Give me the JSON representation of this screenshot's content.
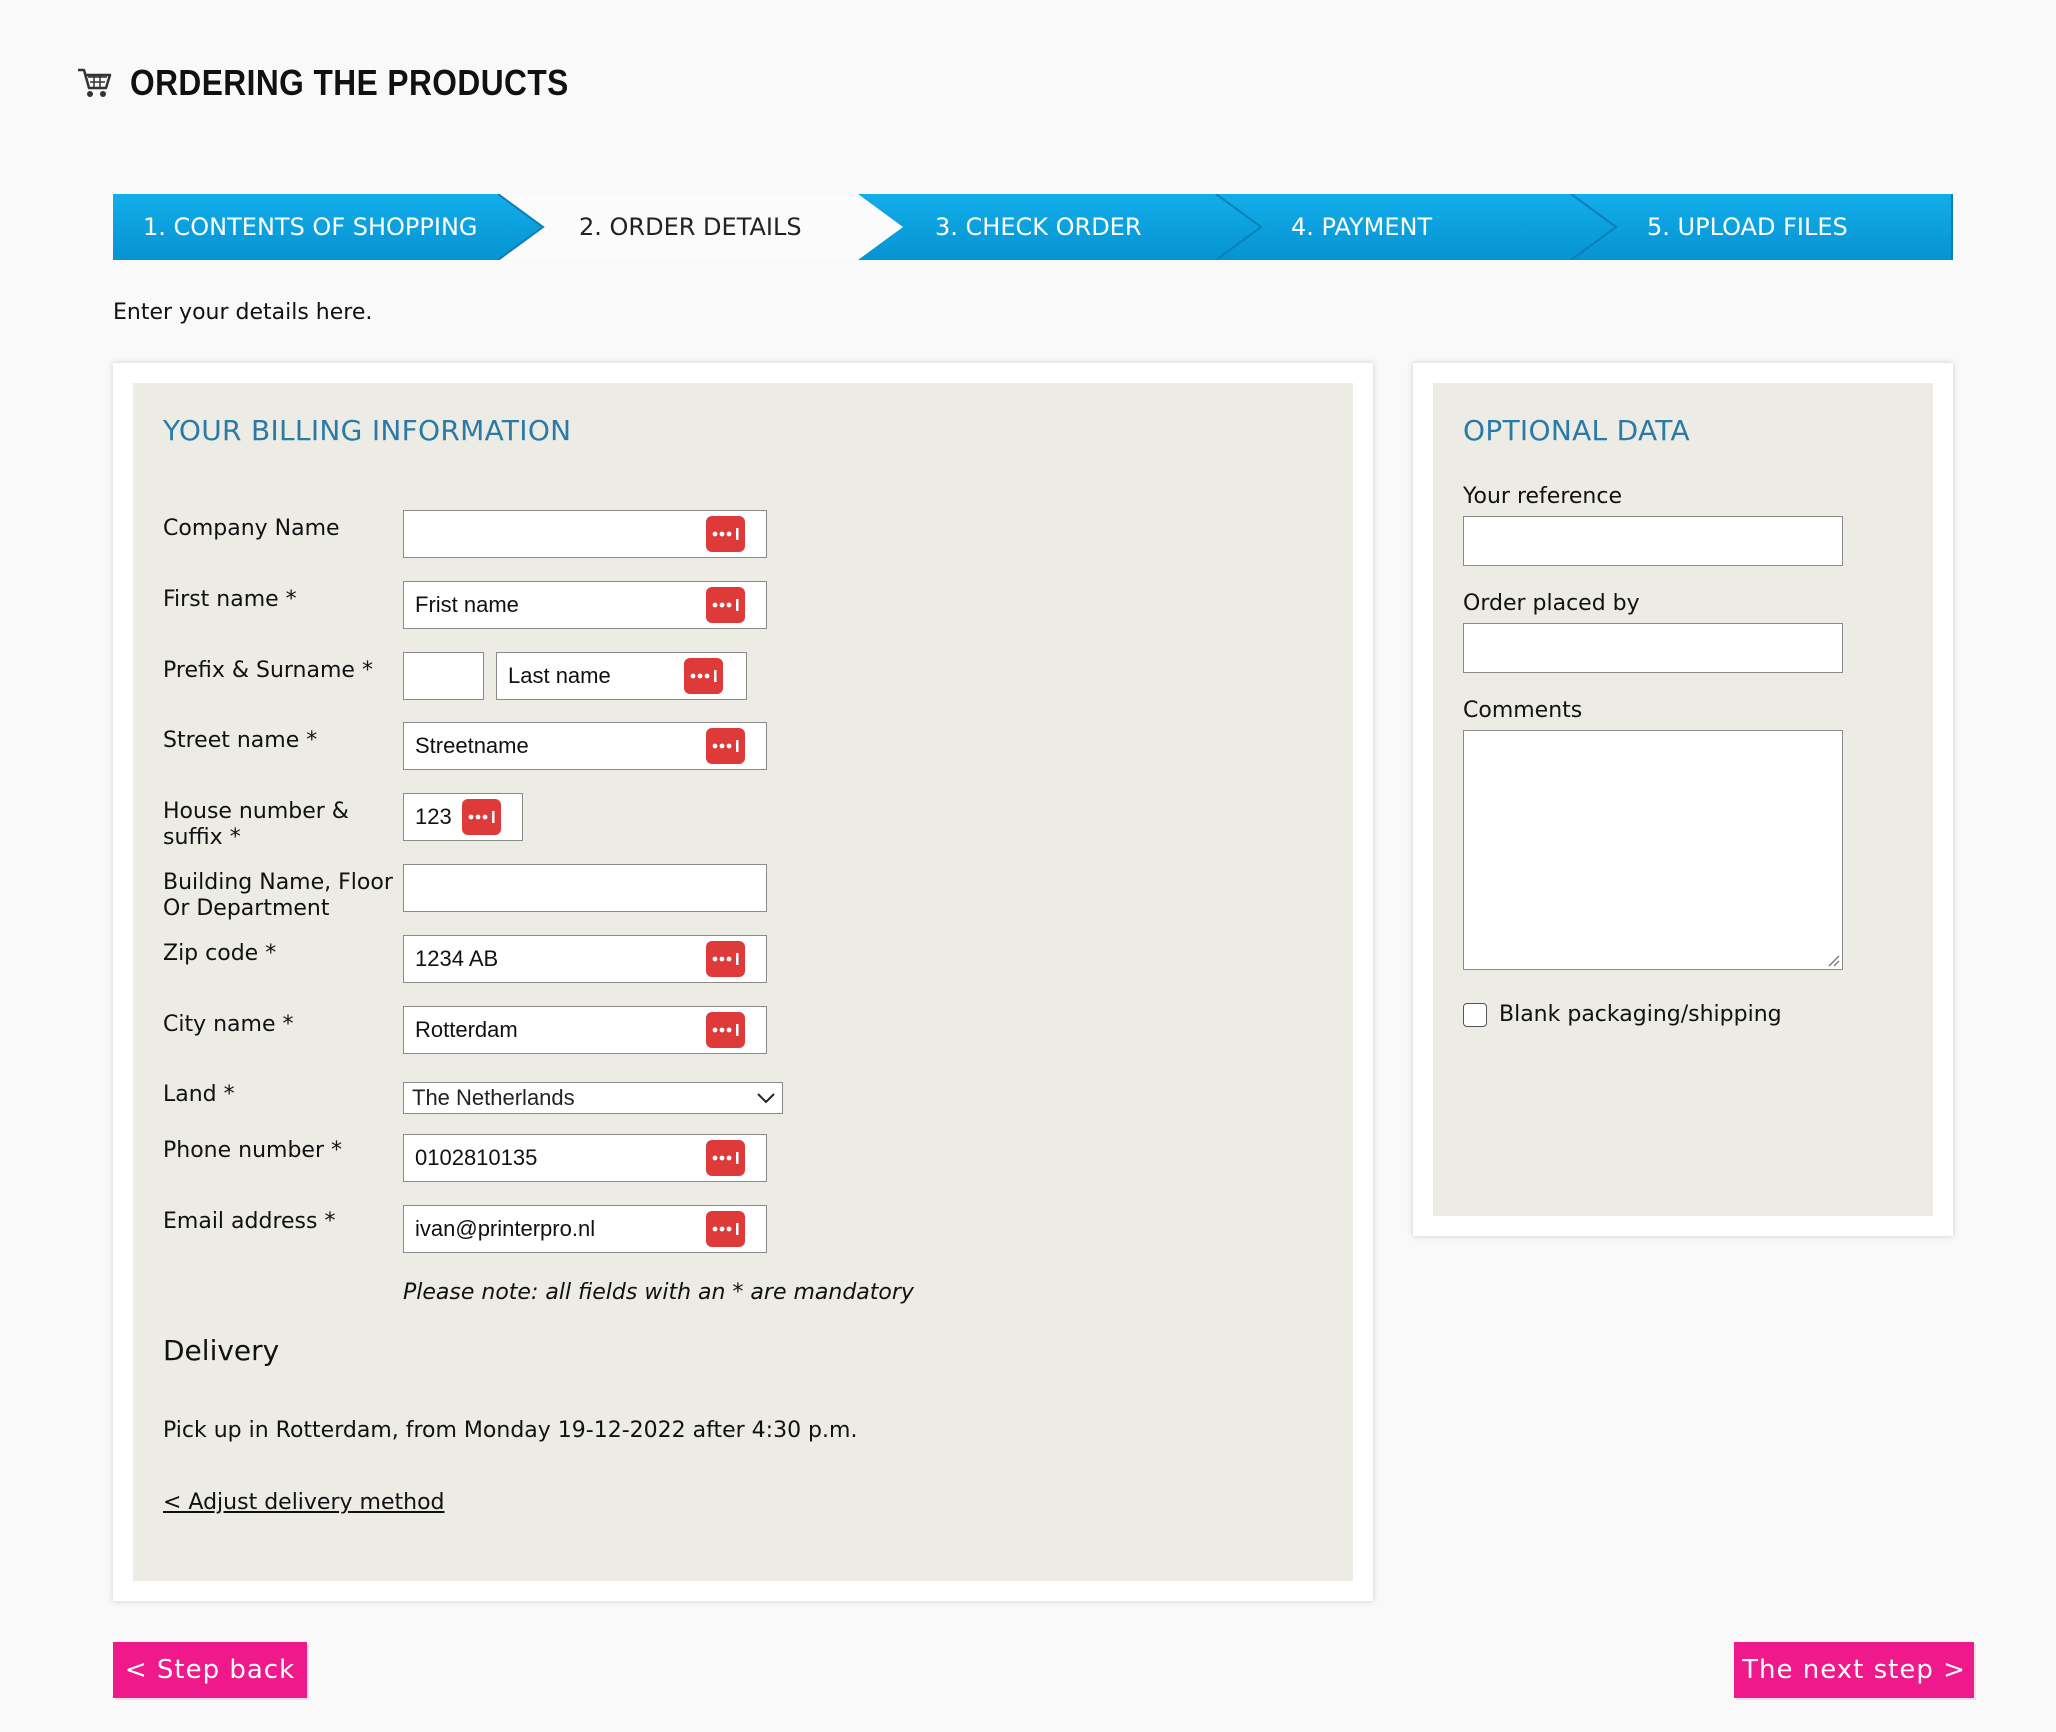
{
  "header": {
    "title": "ORDERING THE PRODUCTS"
  },
  "steps": [
    {
      "label": "1. CONTENTS OF SHOPPING",
      "state": "done"
    },
    {
      "label": "2. ORDER DETAILS",
      "state": "active"
    },
    {
      "label": "3. CHECK ORDER",
      "state": "todo"
    },
    {
      "label": "4. PAYMENT",
      "state": "todo"
    },
    {
      "label": "5. UPLOAD FILES",
      "state": "todo"
    }
  ],
  "intro": "Enter your details here.",
  "billing": {
    "title": "YOUR BILLING INFORMATION",
    "company_label": "Company Name",
    "company_value": "",
    "first_name_label": "First name *",
    "first_name_value": "Frist name",
    "surname_label": "Prefix & Surname *",
    "prefix_value": "",
    "surname_value": "Last name",
    "street_label": "Street name *",
    "street_value": "Streetname",
    "house_label": "House number & suffix *",
    "house_value": "123",
    "building_label": "Building Name, Floor Or Department",
    "building_value": "",
    "zip_label": "Zip code *",
    "zip_value": "1234 AB",
    "city_label": "City name *",
    "city_value": "Rotterdam",
    "land_label": "Land *",
    "land_value": "The Netherlands",
    "phone_label": "Phone number *",
    "phone_value": "0102810135",
    "email_label": "Email address *",
    "email_value": "ivan@printerpro.nl",
    "note": "Please note: all fields with an * are mandatory"
  },
  "delivery": {
    "title": "Delivery",
    "text": "Pick up in Rotterdam, from Monday 19-12-2022 after 4:30 p.m.",
    "link": "< Adjust delivery method"
  },
  "optional": {
    "title": "OPTIONAL DATA",
    "reference_label": "Your reference",
    "placed_by_label": "Order placed by",
    "comments_label": "Comments",
    "blank_label": "Blank packaging/shipping",
    "blank_checked": false
  },
  "buttons": {
    "back": "< Step back",
    "next": "The next step >"
  },
  "colors": {
    "accent": "#2a7aa8",
    "stepper": "#0aa5e4",
    "button": "#f0198b",
    "password_icon": "#df3a3a"
  }
}
